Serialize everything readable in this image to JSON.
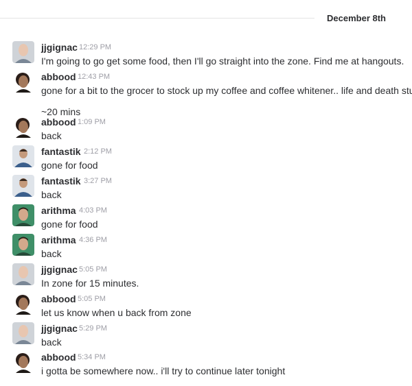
{
  "date_divider": "December 8th",
  "messages": [
    {
      "user": "jjgignac",
      "time": "12:29 PM",
      "text": "I'm going to go get some food, then I'll go straight into the zone.  Find me at hangouts.",
      "avatar": "jjgignac-avatar"
    },
    {
      "user": "abbood",
      "time": "12:43 PM",
      "text": "gone for a bit to the grocer to stock up my coffee and coffee whitener.. life and death stuff",
      "text2": "~20 mins",
      "avatar": "abbood-avatar"
    },
    {
      "user": "abbood",
      "time": "1:09 PM",
      "text": "back",
      "avatar": "abbood-avatar"
    },
    {
      "user": "fantastik",
      "time": "2:12 PM",
      "text": "gone for food",
      "avatar": "fantastik-avatar"
    },
    {
      "user": "fantastik",
      "time": "3:27 PM",
      "text": "back",
      "avatar": "fantastik-avatar"
    },
    {
      "user": "arithma",
      "time": "4:03 PM",
      "text": "gone for food",
      "avatar": "arithma-avatar"
    },
    {
      "user": "arithma",
      "time": "4:36 PM",
      "text": "back",
      "avatar": "arithma-avatar"
    },
    {
      "user": "jjgignac",
      "time": "5:05 PM",
      "text": "In zone for 15 minutes.",
      "avatar": "jjgignac-avatar"
    },
    {
      "user": "abbood",
      "time": "5:05 PM",
      "text": "let us know when u back from zone",
      "avatar": "abbood-avatar"
    },
    {
      "user": "jjgignac",
      "time": "5:29 PM",
      "text": "back",
      "avatar": "jjgignac-avatar"
    },
    {
      "user": "abbood",
      "time": "5:34 PM",
      "text": "i gotta be somewhere now.. i'll try to continue later tonight",
      "avatar": "abbood-avatar"
    }
  ]
}
